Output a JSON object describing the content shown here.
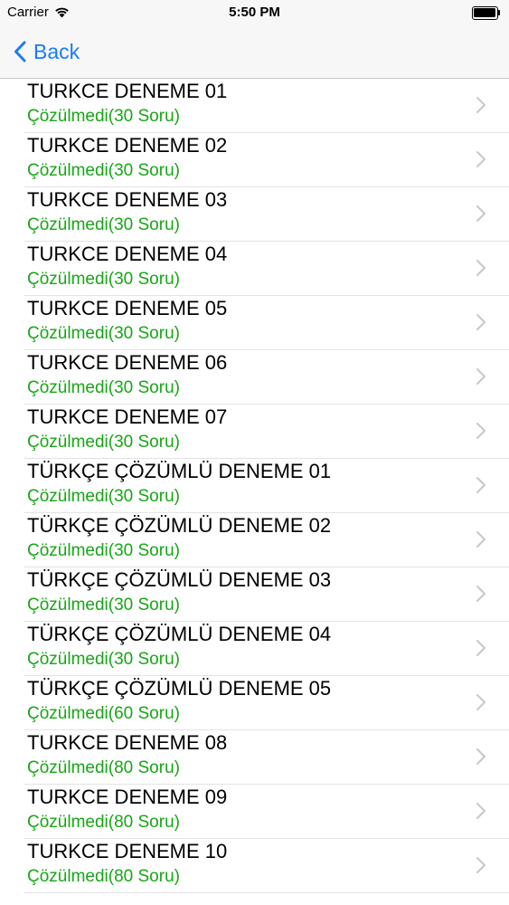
{
  "status": {
    "carrier": "Carrier",
    "time": "5:50 PM",
    "battery_level": 1.0
  },
  "nav": {
    "back_label": "Back",
    "back_icon": "chevron-left-icon"
  },
  "colors": {
    "accent": "#1a7cf5",
    "status_green": "#17a616"
  },
  "items": [
    {
      "title": "TURKCE DENEME 01",
      "status": "Çözülmedi(30 Soru)"
    },
    {
      "title": "TURKCE DENEME 02",
      "status": "Çözülmedi(30 Soru)"
    },
    {
      "title": "TURKCE DENEME 03",
      "status": "Çözülmedi(30 Soru)"
    },
    {
      "title": "TURKCE DENEME 04",
      "status": "Çözülmedi(30 Soru)"
    },
    {
      "title": "TURKCE DENEME 05",
      "status": "Çözülmedi(30 Soru)"
    },
    {
      "title": "TURKCE DENEME 06",
      "status": "Çözülmedi(30 Soru)"
    },
    {
      "title": "TURKCE DENEME 07",
      "status": "Çözülmedi(30 Soru)"
    },
    {
      "title": "TÜRKÇE ÇÖZÜMLÜ DENEME 01",
      "status": "Çözülmedi(30 Soru)"
    },
    {
      "title": "TÜRKÇE ÇÖZÜMLÜ DENEME 02",
      "status": "Çözülmedi(30 Soru)"
    },
    {
      "title": "TÜRKÇE ÇÖZÜMLÜ DENEME 03",
      "status": "Çözülmedi(30 Soru)"
    },
    {
      "title": "TÜRKÇE ÇÖZÜMLÜ DENEME 04",
      "status": "Çözülmedi(30 Soru)"
    },
    {
      "title": "TÜRKÇE ÇÖZÜMLÜ DENEME 05",
      "status": "Çözülmedi(60 Soru)"
    },
    {
      "title": "TURKCE DENEME 08",
      "status": "Çözülmedi(80 Soru)"
    },
    {
      "title": "TURKCE DENEME 09",
      "status": "Çözülmedi(80 Soru)"
    },
    {
      "title": "TURKCE DENEME 10",
      "status": "Çözülmedi(80 Soru)"
    }
  ]
}
